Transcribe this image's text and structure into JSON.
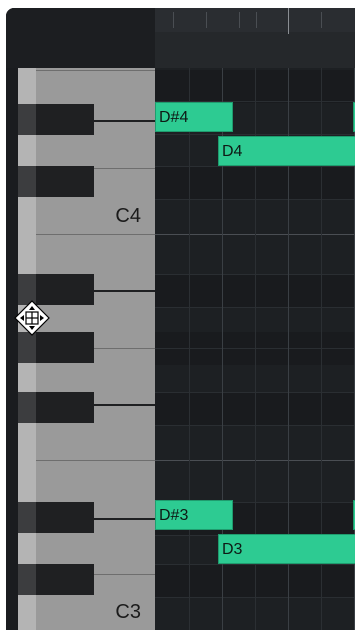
{
  "keyboard": {
    "labels": {
      "c4": "C4",
      "c3": "C3"
    }
  },
  "notes": [
    {
      "name": "D#4"
    },
    {
      "name": "D4"
    },
    {
      "name": "D#3"
    },
    {
      "name": "D3"
    }
  ],
  "colors": {
    "note_fill": "#2dcb92",
    "background": "#1a1c1f",
    "keyboard_white": "#9a9a9a",
    "keyboard_black": "#1f2022"
  },
  "cursor": {
    "icon": "move-cursor-icon"
  }
}
